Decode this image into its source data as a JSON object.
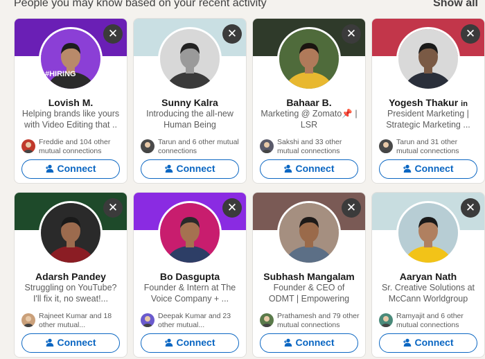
{
  "header": {
    "title": "People you may know based on your recent activity",
    "show_all": "Show all"
  },
  "connect_label": "Connect",
  "close_glyph": "✕",
  "cards": [
    {
      "name": "Lovish M.",
      "headline": "Helping brands like yours with Video Editing that ..",
      "mutual": "Freddie and 104 other mutual connections",
      "banner_color": "#6a1fb5",
      "avatar_bg": "#8b3fd6",
      "skin": "#b98a6a",
      "hair": "#1d1d1d",
      "shirt": "#2b2b2b",
      "mutual_color": "#c0392b",
      "badge_text": "#HIRING"
    },
    {
      "name": "Sunny Kalra",
      "headline": "Introducing the all-new Human Being",
      "mutual": "Tarun and 6 other mutual connections",
      "banner_color": "#c9dfe3",
      "avatar_bg": "#d8d8d8",
      "skin": "#9a9a9a",
      "hair": "#222222",
      "shirt": "#3a3a3a",
      "mutual_color": "#4a4a4a"
    },
    {
      "name": "Bahaar B.",
      "headline": "Marketing @ Zomato📌 | LSR",
      "mutual": "Sakshi and 33 other mutual connections",
      "banner_color": "#2f3a2a",
      "avatar_bg": "#4f6b3b",
      "skin": "#b07a5a",
      "hair": "#1a1410",
      "shirt": "#e8b830",
      "mutual_color": "#5a5a6a"
    },
    {
      "name": "Yogesh Thakur",
      "headline": "President Marketing | Strategic Marketing ...",
      "mutual": "Tarun and 31 other mutual connections",
      "banner_color": "#c2364a",
      "avatar_bg": "#d9d9d9",
      "skin": "#7a5a45",
      "hair": "#1a1a1a",
      "shirt": "#2a2f3a",
      "mutual_color": "#4a4a4a",
      "badge": "in"
    },
    {
      "name": "Adarsh Pandey",
      "headline": "Struggling on YouTube? I'll fix it, no sweat!...",
      "mutual": "Rajneet Kumar and 18 other mutual...",
      "banner_color": "#1e4a2a",
      "avatar_bg": "#2a2a2a",
      "skin": "#9c6b4e",
      "hair": "#1a1a1a",
      "shirt": "#8b1d24",
      "mutual_color": "#caa07a"
    },
    {
      "name": "Bo Dasgupta",
      "headline": "Founder & Intern at The Voice Company + ...",
      "mutual": "Deepak Kumar and 23 other mutual...",
      "banner_color": "#8a2be2",
      "avatar_bg": "#c81d6e",
      "skin": "#a57250",
      "hair": "#2a2a2a",
      "shirt": "#2d3e66",
      "mutual_color": "#6a5acd"
    },
    {
      "name": "Subhash Mangalam",
      "headline": "Founder & CEO of ODMT | Empowering Careers ...",
      "mutual": "Prathamesh and 79 other mutual connections",
      "banner_color": "#7a5a55",
      "avatar_bg": "#a58f80",
      "skin": "#9a6a4a",
      "hair": "#1e1a18",
      "shirt": "#5c6f86",
      "mutual_color": "#5a7a4a"
    },
    {
      "name": "Aaryan Nath",
      "headline": "Sr. Creative Solutions at McCann Worldgroup",
      "mutual": "Ramyajit and 6 other mutual connections",
      "banner_color": "#c8dde0",
      "avatar_bg": "#b7cdd4",
      "skin": "#b08060",
      "hair": "#1a1a1a",
      "shirt": "#f2c318",
      "mutual_color": "#4a8a7a"
    }
  ]
}
